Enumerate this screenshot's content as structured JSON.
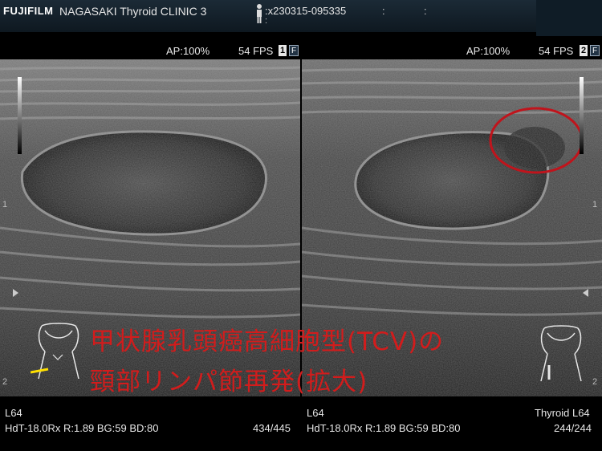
{
  "header": {
    "brand": "FUJIFILM",
    "clinic": "NAGASAKI Thyroid CLINIC 3",
    "patient_id": ":x230315-095335",
    "colon_a": ":",
    "colon_b": ":",
    "colon_c": ":"
  },
  "left_panel": {
    "ap": "AP:100%",
    "fps": "54 FPS",
    "panel_number": "1",
    "mode_badge": "F",
    "depth_marks": [
      "1",
      "2"
    ],
    "probe": "L64",
    "params": "HdT-18.0Rx  R:1.89 BG:59  BD:80",
    "frame_counter": "434/445"
  },
  "right_panel": {
    "ap": "AP:100%",
    "fps": "54 FPS",
    "panel_number": "2",
    "mode_badge": "F",
    "depth_marks": [
      "1",
      "2"
    ],
    "probe": "L64",
    "params": "HdT-18.0Rx  R:1.89 BG:59  BD:80",
    "preset": "Thyroid L64",
    "frame_counter": "244/244"
  },
  "annotation": {
    "line1": "甲状腺乳頭癌高細胞型(TCV)の",
    "line2": "頸部リンパ節再発(拡大)",
    "color": "#d21c1c",
    "circle_color": "#c0141c"
  },
  "icons": [
    "person-icon",
    "neck-bodymark-icon",
    "neck-bodymark-icon-right",
    "orientation-arrow-icon"
  ]
}
